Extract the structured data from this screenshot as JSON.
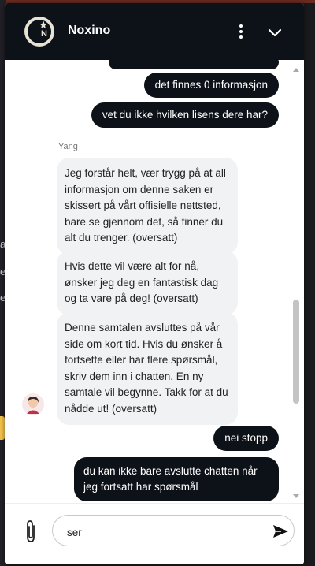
{
  "background": {
    "letters": [
      "a",
      "e",
      "er"
    ]
  },
  "header": {
    "brand": "Noxino",
    "logo_icon": "moon-star-chip-icon",
    "menu_icon": "kebab-menu-icon",
    "collapse_icon": "chevron-down-icon"
  },
  "colors": {
    "header_bg": "#0d1219",
    "user_bubble": "#0d1219",
    "agent_bubble": "#f1f2f4"
  },
  "messages": {
    "user_1": "det finnes 0 informasjon",
    "user_2": "vet du ikke hvilken lisens dere har?",
    "agent_name": "Yang",
    "agent_1": "Jeg forstår helt, vær trygg på at all informasjon om denne saken er skissert på vårt offisielle nettsted, bare se gjennom det, så finner du alt du trenger.  (oversatt)",
    "agent_2": "Hvis dette vil være alt for nå, ønsker jeg deg en fantastisk dag og ta vare på deg! (oversatt)",
    "agent_3": "Denne samtalen avsluttes på vår side om kort tid. Hvis du ønsker å fortsette eller har flere spørsmål, skriv dem inn i chatten. En ny samtale vil begynne. Takk for at du nådde ut! (oversatt)",
    "user_3": "nei stopp",
    "user_4": "du kan ikke bare avslutte chatten når jeg fortsatt har spørsmål"
  },
  "composer": {
    "value": "ser",
    "attach_icon": "paperclip-icon",
    "send_icon": "send-icon"
  }
}
